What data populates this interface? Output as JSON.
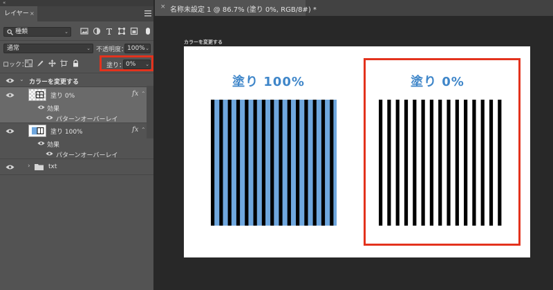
{
  "layers_panel": {
    "collapse_glyph": "«",
    "tab_label": "レイヤー",
    "tab_close": "×",
    "filter": {
      "kind_value": "種類"
    },
    "blend_mode": {
      "value": "通常"
    },
    "opacity": {
      "label": "不透明度：",
      "value": "100%"
    },
    "lock": {
      "label": "ロック："
    },
    "fill": {
      "label": "塗り：",
      "value": "0%"
    },
    "highlight_color": "#e3321d",
    "layers": [
      {
        "type": "group",
        "name": "カラーを変更する",
        "expanded": true
      },
      {
        "type": "layer",
        "name": "塗り 0%",
        "fx": "fx",
        "effects_label": "効果",
        "effect_name": "パターンオーバーレイ"
      },
      {
        "type": "layer",
        "name": "塗り 100%",
        "fx": "fx",
        "effects_label": "効果",
        "effect_name": "パターンオーバーレイ"
      },
      {
        "type": "group",
        "name": "txt",
        "expanded": false
      }
    ]
  },
  "document": {
    "tab_close": "×",
    "title": "名称未設定 1 @ 86.7% (塗り 0%, RGB/8#) *",
    "artboard_label": "カラーを変更する",
    "left_heading": "塗り 100%",
    "right_heading": "塗り 0%",
    "heading_color": "#3f86c9",
    "stripe_fill_color": "#6fa7de",
    "stripe_line_color": "#000000",
    "highlight_color": "#e3321d"
  }
}
